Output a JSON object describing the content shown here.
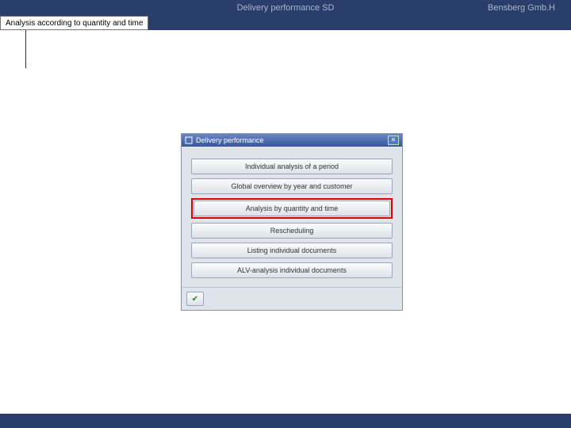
{
  "header": {
    "title": "Delivery performance SD",
    "company": "Bensberg Gmb.H"
  },
  "tab": {
    "label": "Analysis according to quantity and time"
  },
  "dialog": {
    "title": "Delivery performance",
    "options": [
      "Individual analysis of a period",
      "Global overview by year and customer",
      "Analysis by quantity and time",
      "Rescheduling",
      "Listing individual documents",
      "ALV-analysis individual documents"
    ],
    "highlighted_index": 2,
    "ok_glyph": "✔",
    "close_glyph": "✕"
  }
}
